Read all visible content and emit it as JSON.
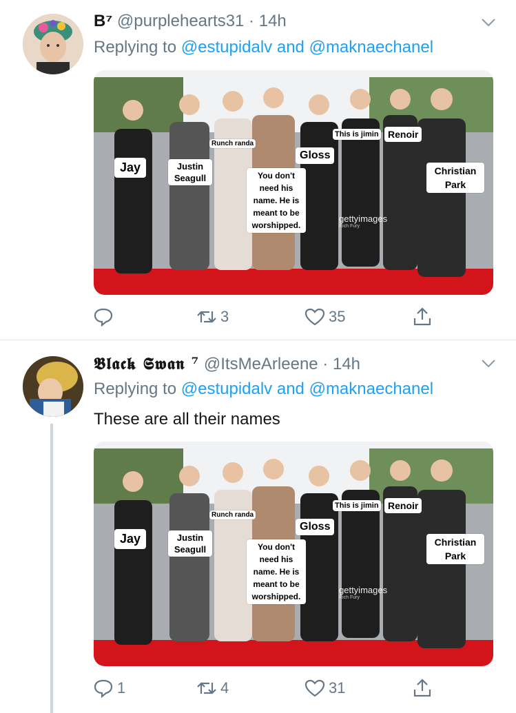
{
  "tweets": [
    {
      "display_name": "B⁷",
      "handle": "@purplehearts31",
      "time": "14h",
      "replying_prefix": "Replying to",
      "mention_1": "@estupidalv",
      "and_word": "and",
      "mention_2": "@maknaechanel",
      "text": "",
      "image": {
        "labels": {
          "runch": "Runch randa",
          "jimin": "This is jimin",
          "renoir": "Renoir",
          "gloss": "Gloss",
          "jay": "Jay",
          "justin": "Justin Seagull",
          "christian": "Christian Park",
          "worship": "You don't need his name. He is meant to be worshipped."
        },
        "watermark": "gettyimages",
        "watermark_credit": "Rich Fury"
      },
      "counts": {
        "reply": "",
        "retweet": "3",
        "like": "35"
      }
    },
    {
      "display_name": "𝕭𝖑𝖆𝖈𝖐 𝕾𝖜𝖆𝖓 ⁷",
      "handle": "@ItsMeArleene",
      "time": "14h",
      "replying_prefix": "Replying to",
      "mention_1": "@estupidalv",
      "and_word": "and",
      "mention_2": "@maknaechanel",
      "text": "These are all their names",
      "image": {
        "labels": {
          "runch": "Runch randa",
          "jimin": "This is jimin",
          "renoir": "Renoir",
          "gloss": "Gloss",
          "jay": "Jay",
          "justin": "Justin Seagull",
          "christian": "Christian Park",
          "worship": "You don't need his name. He is meant to be worshipped."
        },
        "watermark": "gettyimages",
        "watermark_credit": "Rich Fury"
      },
      "counts": {
        "reply": "1",
        "retweet": "4",
        "like": "31"
      }
    }
  ],
  "colors": {
    "accent": "#1da1f2",
    "muted": "#657786",
    "text": "#14171a",
    "carpet": "#d3141b"
  },
  "icons": [
    "chevron-down-icon",
    "reply-icon",
    "retweet-icon",
    "like-icon",
    "share-icon"
  ]
}
